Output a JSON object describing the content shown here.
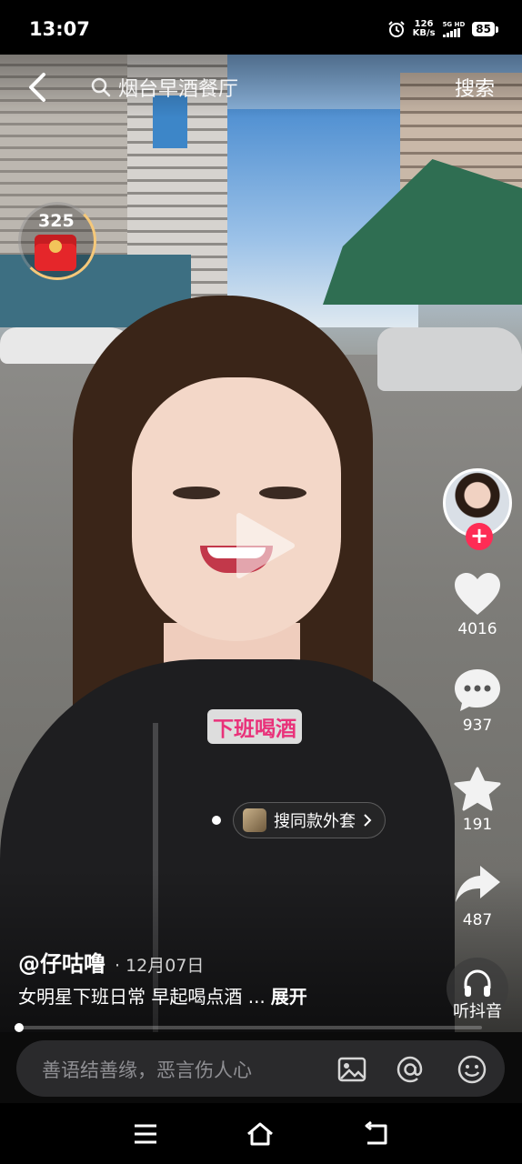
{
  "status_bar": {
    "time": "13:07",
    "net_speed_value": "126",
    "net_speed_unit": "KB/s",
    "signal_label": "5G HD",
    "battery": "85"
  },
  "top_nav": {
    "search_text": "烟台早酒餐厅",
    "search_button": "搜索"
  },
  "red_packet": {
    "count": "325"
  },
  "video": {
    "caption_sticker": "下班喝酒",
    "product_tag": "搜同款外套",
    "progress": 0.004
  },
  "side_actions": {
    "follow": "+",
    "like_count": "4016",
    "comment_count": "937",
    "favorite_count": "191",
    "share_count": "487",
    "listen_label": "听抖音"
  },
  "post": {
    "author": "@仔咕噜",
    "date": "· 12月07日",
    "description": "女明星下班日常 早起喝点酒 ...",
    "expand": "展开"
  },
  "comment_bar": {
    "placeholder": "善语结善缘，恶言伤人心"
  },
  "icons": {
    "back": "chevron-left-icon",
    "search": "search-icon",
    "like": "heart-icon",
    "comment": "comment-dots-icon",
    "favorite": "star-icon",
    "share": "share-arrow-icon",
    "listen": "headphones-icon",
    "image": "image-icon",
    "at": "at-icon",
    "emoji": "emoji-icon"
  },
  "colors": {
    "accent": "#fe2c55",
    "sticker_text": "#e9327a",
    "red_packet": "#e5262a"
  }
}
